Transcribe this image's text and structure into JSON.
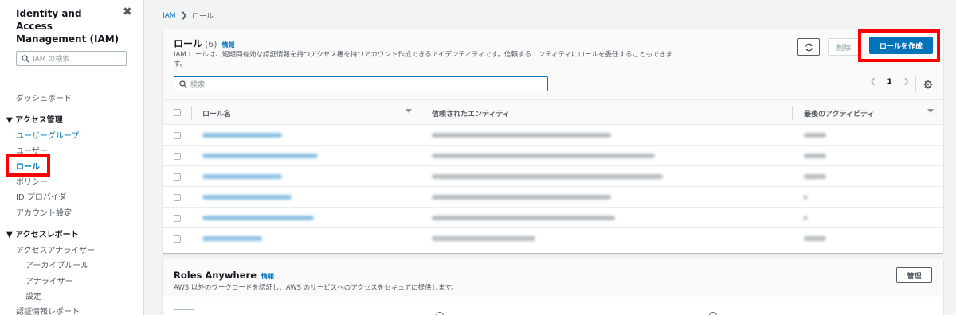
{
  "sidebar": {
    "title": "Identity and Access Management (IAM)",
    "close_glyph": "✖",
    "search_placeholder": "IAM の検索",
    "dashboard": "ダッシュボード",
    "access_mgmt_section": "▼ アクセス管理",
    "user_groups": "ユーザーグループ",
    "users": "ユーザー",
    "roles": "ロール",
    "policies": "ポリシー",
    "id_providers": "ID プロバイダ",
    "account_settings": "アカウント設定",
    "access_reports_section": "▼ アクセスレポート",
    "access_analyzer": "アクセスアナライザー",
    "archive_rules": "アーカイブルール",
    "analyzers": "アナライザー",
    "settings": "設定",
    "credential_report": "認証情報レポート"
  },
  "breadcrumb": {
    "root": "IAM",
    "separator": "❯",
    "current": "ロール"
  },
  "roles_panel": {
    "title": "ロール",
    "count": "(6)",
    "info": "情報",
    "description": "IAM ロールは、短期間有効な認証情報を持つアクセス権を持つアカウント作成できるアイデンティティです。信頼するエンティティにロールを委任することもできます。",
    "delete_label": "削除",
    "create_label": "ロールを作成",
    "search_placeholder": "検索",
    "page_number": "1",
    "prev_glyph": "❮",
    "next_glyph": "❯",
    "columns": [
      "ロール名",
      "信頼されたエンティティ",
      "最後のアクティビティ"
    ],
    "row_count": 6
  },
  "roles_anywhere": {
    "title": "Roles Anywhere",
    "info": "情報",
    "description": "AWS 以外のワークロードを認証し、AWS のサービスへのアクセスをセキュアに提供します。",
    "manage_label": "管理"
  },
  "colors": {
    "primary": "#0073bb",
    "highlight": "#ff0000",
    "link": "#0073bb"
  }
}
